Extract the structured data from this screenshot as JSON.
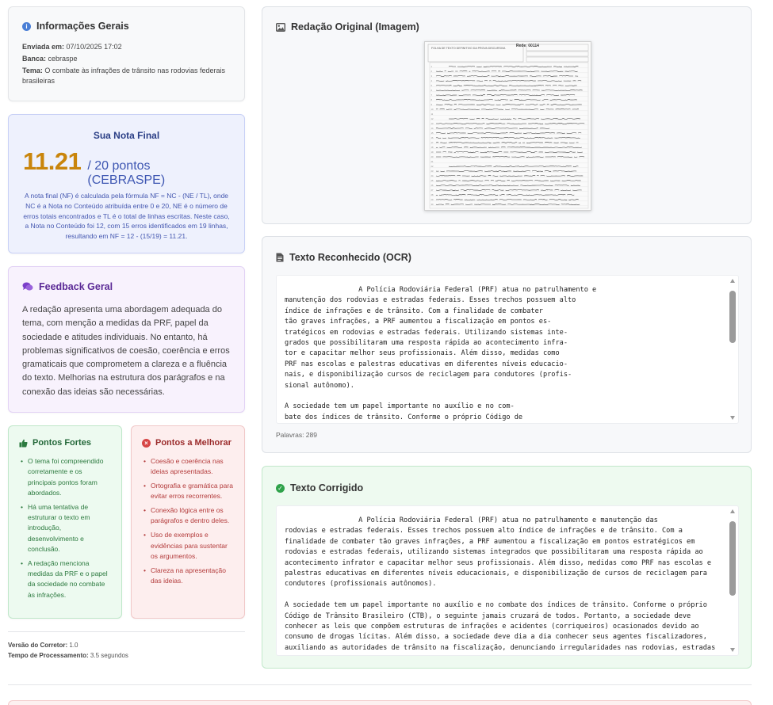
{
  "info": {
    "title": "Informações Gerais",
    "sent_label": "Enviada em:",
    "sent_value": "07/10/2025 17:02",
    "board_label": "Banca:",
    "board_value": "cebraspe",
    "topic_label": "Tema:",
    "topic_value": "O combate às infrações de trânsito nas rodovias federais brasileiras"
  },
  "grade": {
    "title": "Sua Nota Final",
    "value": "11.21",
    "suffix": "/ 20 pontos (CEBRASPE)",
    "explanation": "A nota final (NF) é calculada pela fórmula NF = NC - (NE / TL), onde NC é a Nota no Conteúdo atribuída entre 0 e 20, NE é o número de erros totais encontrados e TL é o total de linhas escritas. Neste caso, a Nota no Conteúdo foi 12, com 15 erros identificados em 19 linhas, resultando em NF = 12 - (15/19) = 11.21."
  },
  "feedback": {
    "title": "Feedback Geral",
    "text": "A redação apresenta uma abordagem adequada do tema, com menção a medidas da PRF, papel da sociedade e atitudes individuais. No entanto, há problemas significativos de coesão, coerência e erros gramaticais que comprometem a clareza e a fluência do texto. Melhorias na estrutura dos parágrafos e na conexão das ideias são necessárias."
  },
  "strengths": {
    "title": "Pontos Fortes",
    "items": [
      "O tema foi compreendido corretamente e os principais pontos foram abordados.",
      "Há uma tentativa de estruturar o texto em introdução, desenvolvimento e conclusão.",
      "A redação menciona medidas da PRF e o papel da sociedade no combate às infrações."
    ]
  },
  "improvements": {
    "title": "Pontos a Melhorar",
    "items": [
      "Coesão e coerência nas ideias apresentadas.",
      "Ortografia e gramática para evitar erros recorrentes.",
      "Conexão lógica entre os parágrafos e dentro deles.",
      "Uso de exemplos e evidências para sustentar os argumentos.",
      "Clareza na apresentação das ideias."
    ]
  },
  "meta": {
    "version_label": "Versão do Corretor:",
    "version_value": "1.0",
    "time_label": "Tempo de Processamento:",
    "time_value": "3.5 segundos"
  },
  "original": {
    "title": "Redação Original (Imagem)",
    "sheet_header": "FOLHA DE TEXTO DEFINITIVO DA PROVA DISCURSIVA",
    "sheet_ref": "Rede: 00114"
  },
  "ocr": {
    "title": "Texto Reconhecido (OCR)",
    "text": "                  A Polícia Rodoviária Federal (PRF) atua no patrulhamento e\nmanutenção dos rodovias e estradas federais. Esses trechos possuem alto\níndice de infrações e de trânsito. Com a finalidade de combater\ntão graves infrações, a PRF aumentou a fiscalização em pontos es-\ntratégicos em rodovias e estradas federais. Utilizando sistemas inte-\ngrados que possibilitaram uma resposta rápida ao acontecimento infra-\ntor e capacitar melhor seus profissionais. Além disso, medidas como\nPRF nas escolas e palestras educativas em diferentes níveis educacio-\nnais, e disponibilização cursos de reciclagem para condutores (profis-\nsional autônomo).\n\nA sociedade tem um papel importante no auxílio e no com-\nbate dos índices de trânsito. Conforme o próprio Código de",
    "word_count": "Palavras: 289"
  },
  "corrected": {
    "title": "Texto Corrigido",
    "text": "                  A Polícia Rodoviária Federal (PRF) atua no patrulhamento e manutenção das\nrodovias e estradas federais. Esses trechos possuem alto índice de infrações e de trânsito. Com a\nfinalidade de combater tão graves infrações, a PRF aumentou a fiscalização em pontos estratégicos em\nrodovias e estradas federais, utilizando sistemas integrados que possibilitaram uma resposta rápida ao\nacontecimento infrator e capacitar melhor seus profissionais. Além disso, medidas como PRF nas escolas e\npalestras educativas em diferentes níveis educacionais, e disponibilização de cursos de reciclagem para\ncondutores (profissionais autônomos).\n\nA sociedade tem um papel importante no auxílio e no combate dos índices de trânsito. Conforme o próprio\nCódigo de Trânsito Brasileiro (CTB), o seguinte jamais cruzará de todos. Portanto, a sociedade deve\nconhecer as leis que compõem estruturas de infrações e acidentes (corriqueiros) ocasionados devido ao\nconsumo de drogas lícitas. Além disso, a sociedade deve dia a dia conhecer seus agentes fiscalizadores,\nauxiliando as autoridades de trânsito na fiscalização, denunciando irregularidades nas rodovias, estradas"
  },
  "colors": {
    "grade_value": "#c9850c",
    "grade_text": "#3d56b2",
    "strength_green": "#2c7a3f",
    "improve_red": "#b33b3b",
    "feedback_purple": "#7b3fc9",
    "info_blue": "#4a7fd6"
  },
  "icons": [
    "info-icon",
    "image-icon",
    "document-icon",
    "chat-icon",
    "thumbs-up-icon",
    "x-circle-icon",
    "check-circle-icon"
  ]
}
